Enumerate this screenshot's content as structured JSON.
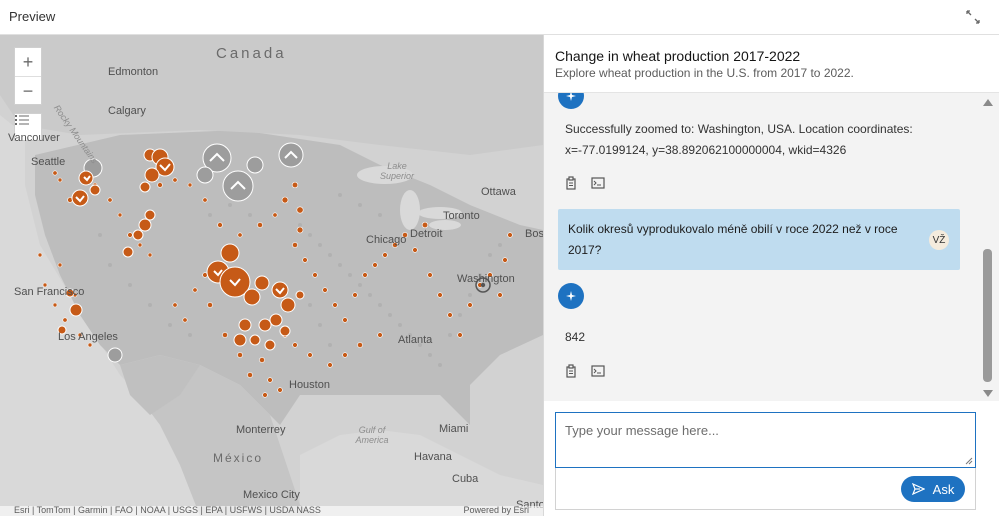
{
  "window": {
    "title": "Preview",
    "expand_icon": "expand-icon"
  },
  "map": {
    "controls": {
      "zoom_in": "+",
      "zoom_out": "−",
      "legend_icon": "list-icon"
    },
    "labels": {
      "canada": "Canada",
      "edmonton": "Edmonton",
      "calgary": "Calgary",
      "rocky": "Rocky Mountains",
      "vancouver": "Vancouver",
      "seattle": "Seattle",
      "lake_superior": "Lake\nSuperior",
      "ottawa": "Ottawa",
      "toronto": "Toronto",
      "chicago": "Chicago",
      "detroit": "Detroit",
      "bos": "Bos",
      "washington": "Washington",
      "san_francisco": "San Francisco",
      "los_angeles": "Los Angeles",
      "atlanta": "Atlanta",
      "houston": "Houston",
      "monterrey": "Monterrey",
      "gulf": "Gulf of America",
      "miami": "Miami",
      "mexico": "México",
      "havana": "Havana",
      "cuba": "Cuba",
      "mexico_city": "Mexico City",
      "santo": "Santo"
    },
    "attribution_left": "Esri | TomTom | Garmin | FAO | NOAA | USGS | EPA | USFWS | USDA NASS",
    "attribution_right": "Powered by Esri",
    "colors": {
      "accent": "#c65a17",
      "cluster_gray": "#9a9a9a"
    }
  },
  "panel": {
    "title": "Change in wheat production 2017-2022",
    "subtitle": "Explore wheat production in the U.S. from 2017 to 2022.",
    "messages": [
      {
        "role": "assistant",
        "text": "Successfully zoomed to: Washington, USA. Location coordinates: x=-77.0199124, y=38.892062100000004, wkid=4326"
      },
      {
        "role": "user",
        "text": "Kolik okresů vyprodukovalo méně obilí v roce 2022 než v roce 2017?",
        "avatar": "VŽ"
      },
      {
        "role": "assistant",
        "text": "842"
      }
    ],
    "input": {
      "placeholder": "Type your message here...",
      "value": ""
    },
    "ask_label": "Ask",
    "colors": {
      "user_bubble": "#bfdcef",
      "primary": "#1e72c1"
    }
  }
}
